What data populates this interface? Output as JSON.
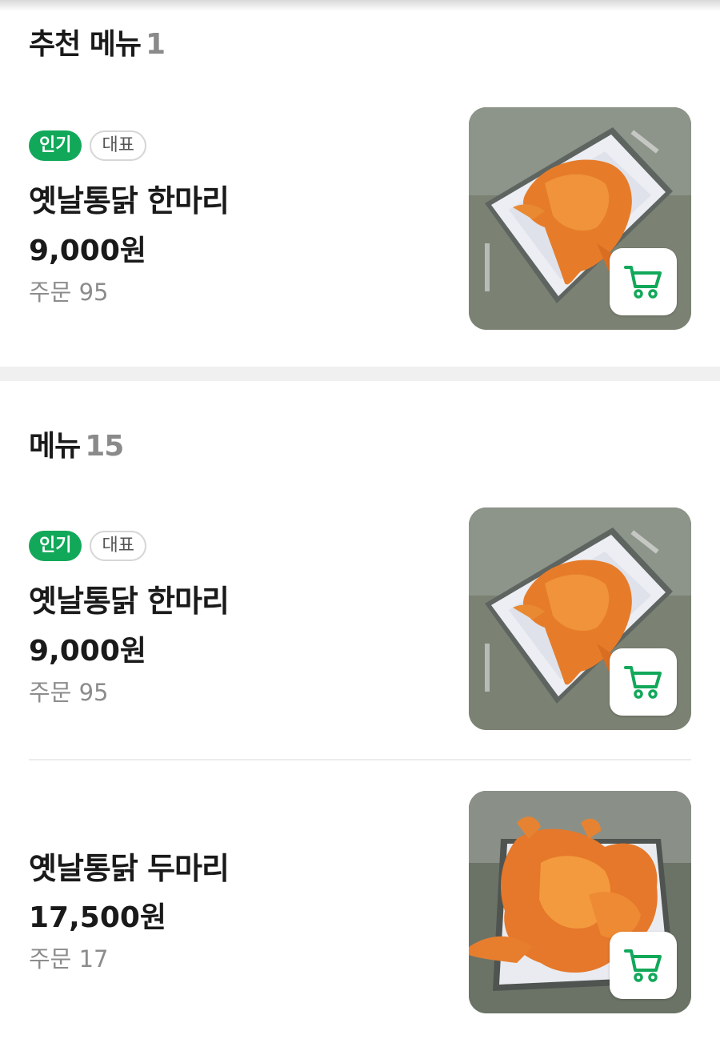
{
  "recommended": {
    "title": "추천 메뉴",
    "count": "1",
    "items": [
      {
        "badges": [
          "인기",
          "대표"
        ],
        "name": "옛날통닭 한마리",
        "price": "9,000원",
        "orders": "주문 95",
        "image": "fried-chicken-whole"
      }
    ]
  },
  "menu": {
    "title": "메뉴",
    "count": "15",
    "items": [
      {
        "badges": [
          "인기",
          "대표"
        ],
        "name": "옛날통닭 한마리",
        "price": "9,000원",
        "orders": "주문 95",
        "image": "fried-chicken-whole"
      },
      {
        "name": "옛날통닭 두마리",
        "price": "17,500원",
        "orders": "주문 17",
        "image": "fried-chicken-two"
      }
    ]
  },
  "icons": {
    "cart": "cart-icon"
  },
  "colors": {
    "accent": "#12a85a",
    "muted": "#8c8c8c",
    "text": "#1a1a1a"
  }
}
